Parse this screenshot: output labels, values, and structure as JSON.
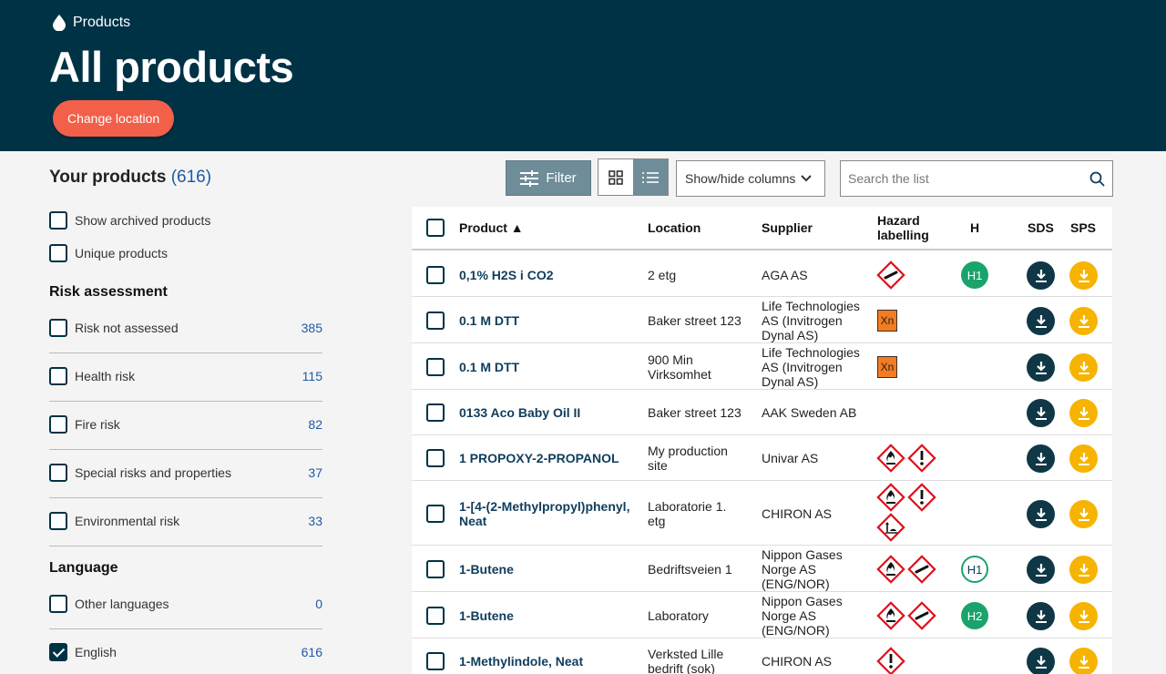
{
  "header": {
    "breadcrumb": "Products",
    "title": "All products",
    "change_location": "Change location"
  },
  "sidebar": {
    "title": "Your products",
    "count": "(616)",
    "options": [
      {
        "label": "Show archived products"
      },
      {
        "label": "Unique products"
      }
    ],
    "risk_title": "Risk assessment",
    "risks": [
      {
        "label": "Risk not assessed",
        "count": "385"
      },
      {
        "label": "Health risk",
        "count": "115"
      },
      {
        "label": "Fire risk",
        "count": "82"
      },
      {
        "label": "Special risks and properties",
        "count": "37"
      },
      {
        "label": "Environmental risk",
        "count": "33"
      }
    ],
    "language_title": "Language",
    "languages": [
      {
        "label": "Other languages",
        "count": "0",
        "checked": false
      },
      {
        "label": "English",
        "count": "616",
        "checked": true
      }
    ]
  },
  "toolbar": {
    "filter": "Filter",
    "columns": "Show/hide columns",
    "search_placeholder": "Search the list"
  },
  "table": {
    "headers": {
      "product": "Product ▲",
      "location": "Location",
      "supplier": "Supplier",
      "hazard1": "Hazard",
      "hazard2": "labelling",
      "h": "H",
      "sds": "SDS",
      "sps": "SPS"
    },
    "rows": [
      {
        "product": [
          "0,1% H2S i CO2"
        ],
        "location": [
          "2 etg"
        ],
        "supplier": [
          "AGA AS"
        ],
        "hazards": [
          "gas-cylinder"
        ],
        "h": "H1",
        "h_style": "solid"
      },
      {
        "product": [
          "0.1 M DTT"
        ],
        "location": [
          "Baker street 123"
        ],
        "supplier": [
          "Life Technologies",
          "AS (Invitrogen",
          "Dynal AS)"
        ],
        "hazards": [
          "xn"
        ],
        "h": "",
        "h_style": ""
      },
      {
        "product": [
          "0.1 M DTT"
        ],
        "location": [
          "900 Min",
          "Virksomhet"
        ],
        "supplier": [
          "Life Technologies",
          "AS (Invitrogen",
          "Dynal AS)"
        ],
        "hazards": [
          "xn"
        ],
        "h": "",
        "h_style": ""
      },
      {
        "product": [
          "0133 Aco Baby Oil II"
        ],
        "location": [
          "Baker street 123"
        ],
        "supplier": [
          "AAK Sweden AB"
        ],
        "hazards": [],
        "h": "",
        "h_style": ""
      },
      {
        "product": [
          "1 PROPOXY-2-PROPANOL"
        ],
        "location": [
          "My production",
          "site"
        ],
        "supplier": [
          "Univar AS"
        ],
        "hazards": [
          "flame",
          "exclamation"
        ],
        "h": "",
        "h_style": ""
      },
      {
        "product": [
          "1-[4-(2-Methylpropyl)phenyl,",
          "Neat"
        ],
        "location": [
          "Laboratorie 1.",
          "etg"
        ],
        "supplier": [
          "CHIRON AS"
        ],
        "hazards": [
          "flame",
          "exclamation",
          "environment"
        ],
        "h": "",
        "h_style": ""
      },
      {
        "product": [
          "1-Butene"
        ],
        "location": [
          "Bedriftsveien 1"
        ],
        "supplier": [
          "Nippon Gases",
          "Norge AS",
          "(ENG/NOR)"
        ],
        "hazards": [
          "flame",
          "gas-cylinder"
        ],
        "h": "H1",
        "h_style": "outline"
      },
      {
        "product": [
          "1-Butene"
        ],
        "location": [
          "Laboratory"
        ],
        "supplier": [
          "Nippon Gases",
          "Norge AS",
          "(ENG/NOR)"
        ],
        "hazards": [
          "flame",
          "gas-cylinder"
        ],
        "h": "H2",
        "h_style": "solid"
      },
      {
        "product": [
          "1-Methylindole, Neat"
        ],
        "location": [
          "Verksted Lille",
          "bedrift (sok)"
        ],
        "supplier": [
          "CHIRON AS"
        ],
        "hazards": [
          "exclamation"
        ],
        "h": "",
        "h_style": ""
      }
    ]
  }
}
